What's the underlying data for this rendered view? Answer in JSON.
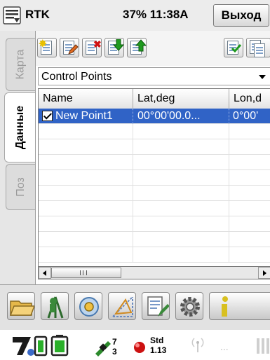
{
  "titlebar": {
    "app_title": "RTK",
    "status": "37% 11:38A",
    "exit_label": "Выход"
  },
  "side_tabs": [
    {
      "label": "Карта",
      "active": false
    },
    {
      "label": "Данные",
      "active": true
    },
    {
      "label": "Поз",
      "active": false
    }
  ],
  "toolbar": {
    "buttons": [
      "new-point-icon",
      "edit-point-icon",
      "delete-point-icon",
      "import-icon",
      "export-icon",
      "checklist-icon",
      "copy-icon"
    ]
  },
  "dataset_select": {
    "value": "Control Points"
  },
  "table": {
    "columns": [
      "Name",
      "Lat,deg",
      "Lon,d"
    ],
    "rows": [
      {
        "checked": true,
        "name": "New Point1",
        "lat": "00°00'00.0...",
        "lon": "0°00'"
      }
    ]
  },
  "bottom_toolbar": {
    "buttons": [
      "folder-icon",
      "survey-icon",
      "stakeout-icon",
      "cogo-icon",
      "notes-icon",
      "settings-icon",
      "info-icon"
    ]
  },
  "status_bar": {
    "satellites_count": "7",
    "satellites_used": "3",
    "solution_label": "Std",
    "precision_value": "1.13",
    "dots": "..."
  },
  "colors": {
    "selection": "#3063c6",
    "accent_green": "#2c8a2c",
    "accent_red": "#cc1111"
  }
}
